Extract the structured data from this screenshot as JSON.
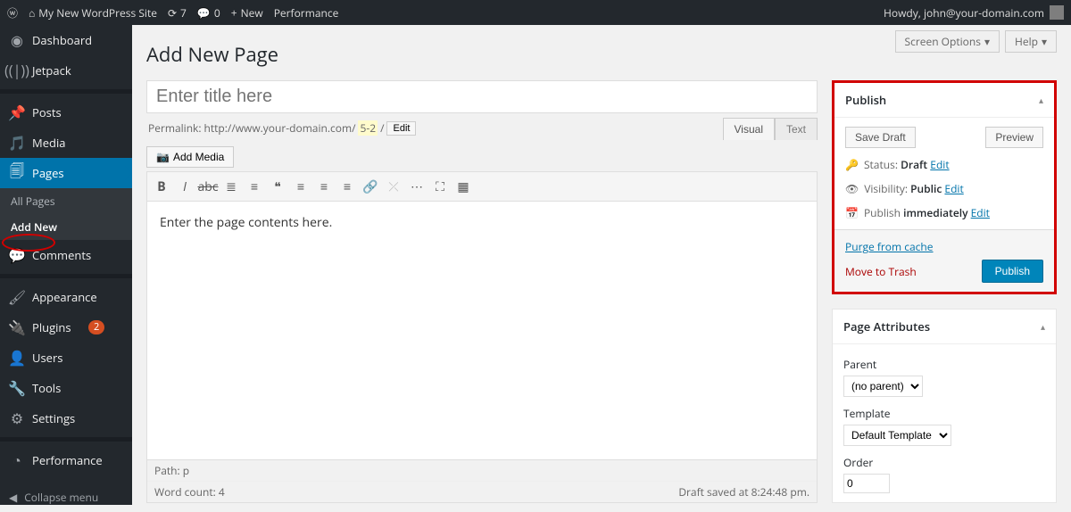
{
  "adminBar": {
    "siteName": "My New WordPress Site",
    "updates": "7",
    "comments": "0",
    "newLabel": "New",
    "performance": "Performance",
    "howdy": "Howdy, john@your-domain.com"
  },
  "sidebar": {
    "dashboard": "Dashboard",
    "jetpack": "Jetpack",
    "posts": "Posts",
    "media": "Media",
    "pages": "Pages",
    "allPages": "All Pages",
    "addNew": "Add New",
    "comments": "Comments",
    "appearance": "Appearance",
    "plugins": "Plugins",
    "pluginsBadge": "2",
    "users": "Users",
    "tools": "Tools",
    "settings": "Settings",
    "performance": "Performance",
    "collapse": "Collapse menu"
  },
  "screenButtons": {
    "screenOptions": "Screen Options",
    "help": "Help"
  },
  "page": {
    "title": "Add New Page",
    "titlePlaceholder": "Enter title here",
    "permalinkLabel": "Permalink:",
    "permalinkBase": "http://www.your-domain.com/",
    "permalinkSlug": "5-2",
    "permalinkTrail": "/",
    "editBtn": "Edit",
    "addMedia": "Add Media",
    "tabVisual": "Visual",
    "tabText": "Text",
    "bodyContent": "Enter the page contents here.",
    "path": "Path: p",
    "wordCount": "Word count: 4",
    "draftSaved": "Draft saved at 8:24:48 pm."
  },
  "publishBox": {
    "title": "Publish",
    "saveDraft": "Save Draft",
    "preview": "Preview",
    "statusLabel": "Status:",
    "statusValue": "Draft",
    "visibilityLabel": "Visibility:",
    "visibilityValue": "Public",
    "publishLabel": "Publish",
    "publishValue": "immediately",
    "edit": "Edit",
    "purge": "Purge from cache",
    "trash": "Move to Trash",
    "publishBtn": "Publish"
  },
  "pageAttr": {
    "title": "Page Attributes",
    "parentLabel": "Parent",
    "parentValue": "(no parent)",
    "templateLabel": "Template",
    "templateValue": "Default Template",
    "orderLabel": "Order",
    "orderValue": "0"
  }
}
